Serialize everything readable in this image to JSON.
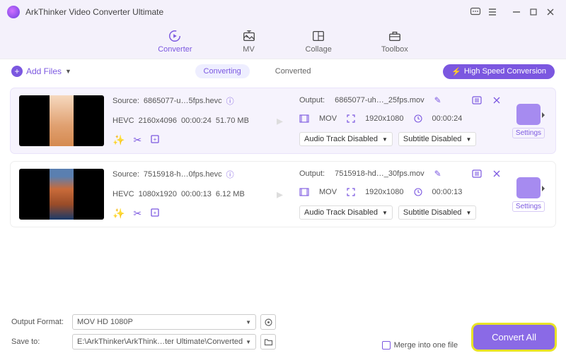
{
  "titlebar": {
    "app_name": "ArkThinker Video Converter Ultimate"
  },
  "main_tabs": [
    {
      "label": "Converter",
      "active": true
    },
    {
      "label": "MV",
      "active": false
    },
    {
      "label": "Collage",
      "active": false
    },
    {
      "label": "Toolbox",
      "active": false
    }
  ],
  "subbar": {
    "add_files": "Add Files",
    "tabs": {
      "converting": "Converting",
      "converted": "Converted"
    },
    "hsc": "High Speed Conversion"
  },
  "items": [
    {
      "source_label": "Source:",
      "source_name": "6865077-u…5fps.hevc",
      "codec": "HEVC",
      "resolution": "2160x4096",
      "duration": "00:00:24",
      "size": "51.70 MB",
      "output_label": "Output:",
      "output_name": "6865077-uh…_25fps.mov",
      "container": "MOV",
      "out_res": "1920x1080",
      "out_dur": "00:00:24",
      "audio": "Audio Track Disabled",
      "subtitle": "Subtitle Disabled",
      "settings": "Settings"
    },
    {
      "source_label": "Source:",
      "source_name": "7515918-h…0fps.hevc",
      "codec": "HEVC",
      "resolution": "1080x1920",
      "duration": "00:00:13",
      "size": "6.12 MB",
      "output_label": "Output:",
      "output_name": "7515918-hd…_30fps.mov",
      "container": "MOV",
      "out_res": "1920x1080",
      "out_dur": "00:00:13",
      "audio": "Audio Track Disabled",
      "subtitle": "Subtitle Disabled",
      "settings": "Settings"
    }
  ],
  "bottom": {
    "output_format_label": "Output Format:",
    "output_format_value": "MOV HD 1080P",
    "save_to_label": "Save to:",
    "save_to_value": "E:\\ArkThinker\\ArkThink…ter Ultimate\\Converted",
    "merge": "Merge into one file",
    "convert_all": "Convert All"
  }
}
